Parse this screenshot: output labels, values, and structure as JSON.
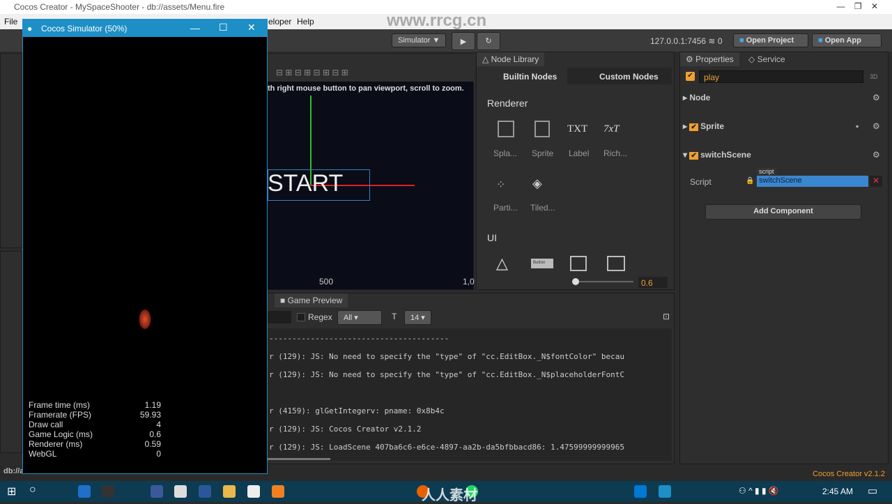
{
  "window": {
    "title": "Cocos Creator - MySpaceShooter - db://assets/Menu.fire"
  },
  "menu": {
    "file": "File",
    "developer": "eloper",
    "help": "Help"
  },
  "toolbar": {
    "platform": "Simulator ▼",
    "play": "▶",
    "refresh": "↻",
    "ip": "127.0.0.1:7456",
    "connections": "0",
    "open_project": "Open Project",
    "open_app": "Open App"
  },
  "simulator": {
    "title": "Cocos Simulator (50%)",
    "stats": [
      {
        "label": "Frame time (ms)",
        "value": "1.19"
      },
      {
        "label": "Framerate (FPS)",
        "value": "59.93"
      },
      {
        "label": "Draw call",
        "value": "4"
      },
      {
        "label": "Game Logic (ms)",
        "value": "0.6"
      },
      {
        "label": "Renderer (ms)",
        "value": "0.59"
      },
      {
        "label": "WebGL",
        "value": "0"
      }
    ]
  },
  "scene": {
    "hint": "th right mouse button to pan viewport, scroll to zoom.",
    "start_label": "START",
    "ruler_500": "500",
    "ruler_1000": "1,0"
  },
  "node_library": {
    "tab": "Node Library",
    "builtin": "Builtin Nodes",
    "custom": "Custom Nodes",
    "renderer_heading": "Renderer",
    "ui_heading": "UI",
    "items": [
      "Spla...",
      "Sprite",
      "Label",
      "Rich...",
      "Parti...",
      "Tiled..."
    ],
    "txt": "TXT",
    "rich": "7xT",
    "button_icon": "Button",
    "zoom": "0.6"
  },
  "properties": {
    "tab": "Properties",
    "service_tab": "Service",
    "node_name": "play",
    "three_d": "3D",
    "node_section": "Node",
    "sprite_section": "Sprite",
    "script_component": "switchScene",
    "script_label": "Script",
    "script_tag": "script",
    "script_value": "switchScene",
    "add_component": "Add Component"
  },
  "console": {
    "tab": "Game Preview",
    "regex": "Regex",
    "filter": "All",
    "font_size": "14",
    "lines": [
      "---------------------------------------",
      "r (129): JS: No need to specify the \"type\" of \"cc.EditBox._N$fontColor\" becau",
      "r (129): JS: No need to specify the \"type\" of \"cc.EditBox._N$placeholderFontC",
      "",
      "r (4159): glGetIntegerv: pname: 0x8b4c",
      "r (129): JS: Cocos Creator v2.1.2",
      "r (129): JS: LoadScene 407ba6c6-e6ce-4897-aa2b-da5bfbbacd86: 1.47599999999965"
    ]
  },
  "status": {
    "path": "db://a",
    "version": "Cocos Creator v2.1.2"
  },
  "taskbar": {
    "time": "2:45 AM"
  },
  "watermark": {
    "site": "www.rrcg.cn",
    "brand": "人人素材"
  },
  "colors": {
    "accent": "#1e8fc6",
    "orange": "#f0a030",
    "selection": "#3b86d0"
  }
}
